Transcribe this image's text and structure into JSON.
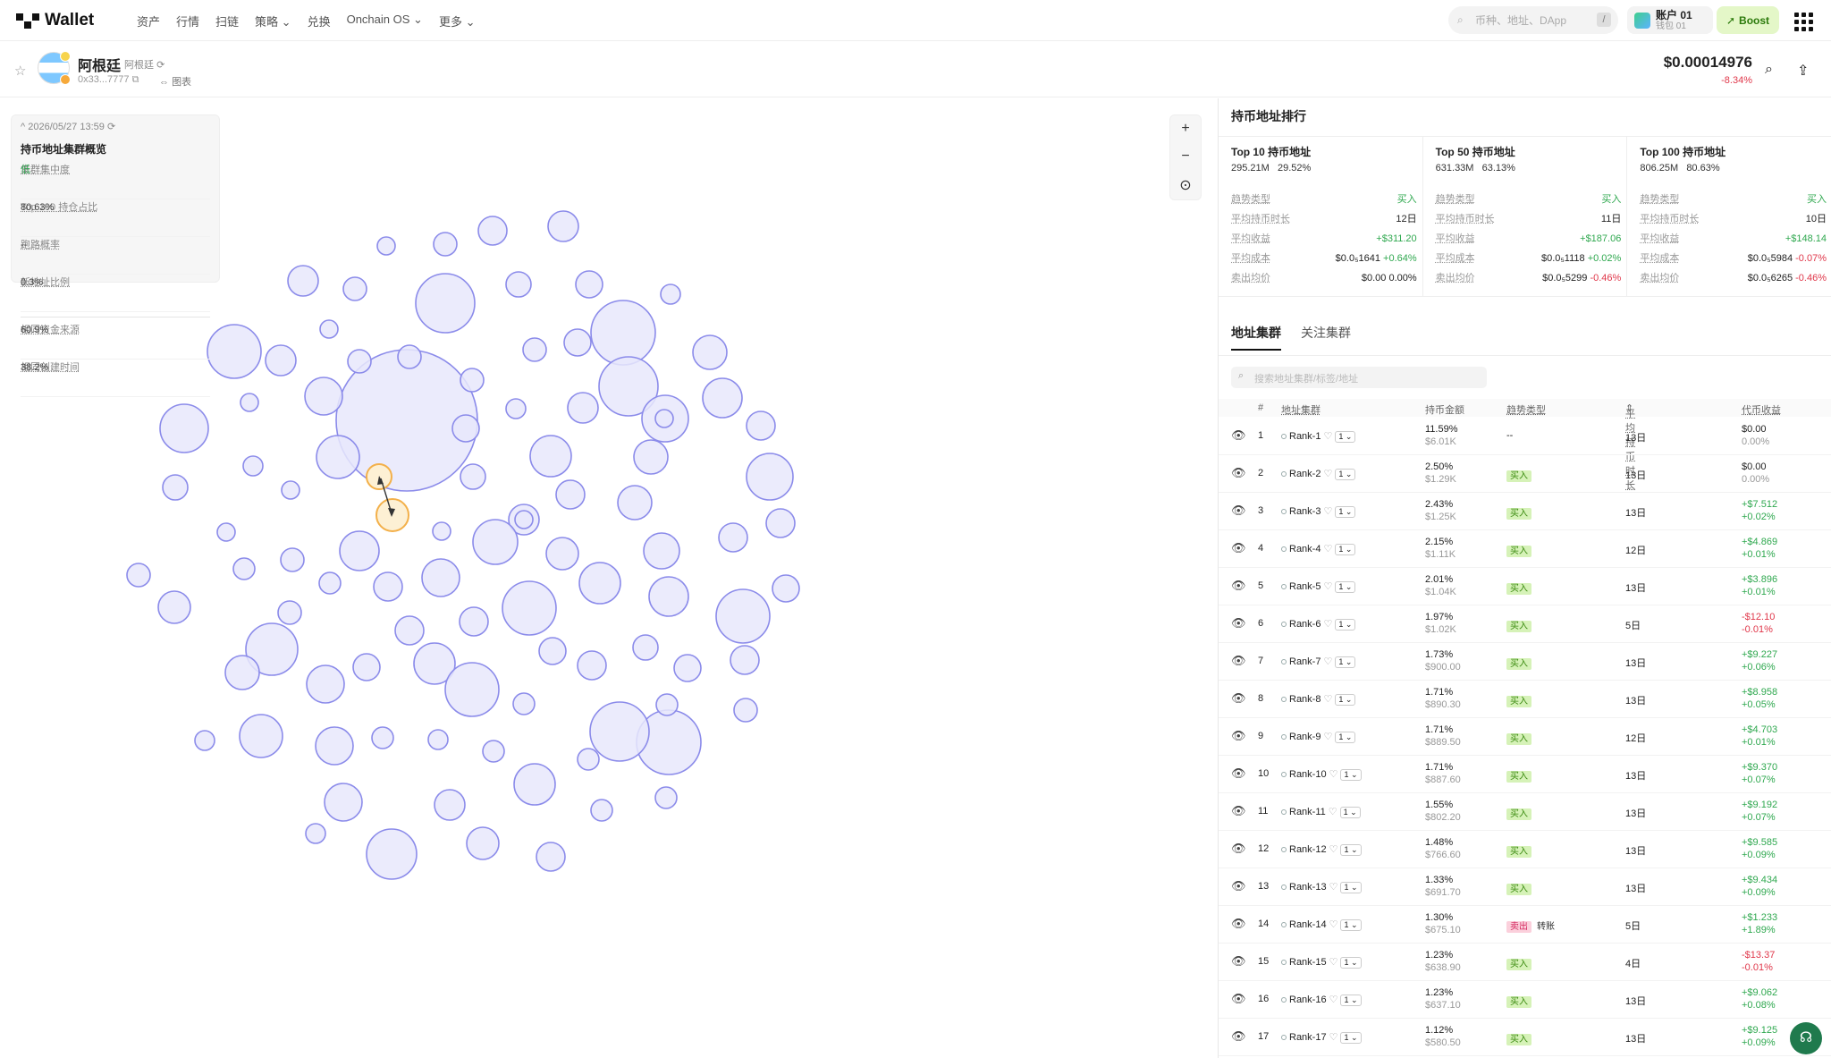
{
  "nav": {
    "logo": "Wallet",
    "menu": [
      "资产",
      "行情",
      "扫链",
      "策略",
      "兑换",
      "Onchain OS",
      "更多"
    ],
    "search_placeholder": "币种、地址、DApp",
    "search_shortcut": "/",
    "account_name": "账户 01",
    "account_sub": "钱包 01",
    "boost_label": "Boost"
  },
  "token": {
    "name": "阿根廷",
    "sub": "阿根廷",
    "address": "0x33...7777",
    "chart_link": "图表",
    "price": "$0.00014976",
    "change": "-8.34%"
  },
  "snapshot": {
    "datetime": "2026/05/27 13:59",
    "title": "持币地址集群概览",
    "rows": [
      {
        "k": "集群集中度",
        "v": "低",
        "green": true
      },
      {
        "k": "Top 100 持仓占比",
        "v": "80.63%"
      },
      {
        "k": "跑路概率",
        "v": "--"
      },
      {
        "k": "新地址比例",
        "v": "0.3%"
      }
    ],
    "rows2": [
      {
        "k": "相同资金来源",
        "v": "60.9%"
      },
      {
        "k": "相同创建时间",
        "v": "38.2%"
      }
    ]
  },
  "zoom": {
    "in": "+",
    "out": "−",
    "center": "⊙"
  },
  "panel": {
    "title": "持币地址排行",
    "tops": [
      {
        "title": "Top 10 持币地址",
        "amount": "295.21M",
        "pct": "29.52%",
        "trend": "买入",
        "hold": "12日",
        "profit": "+$311.20",
        "cost": "$0.0₅1641",
        "cost_chg": "+0.64%",
        "sell": "$0.00",
        "sell_chg": "0.00%"
      },
      {
        "title": "Top 50 持币地址",
        "amount": "631.33M",
        "pct": "63.13%",
        "trend": "买入",
        "hold": "11日",
        "profit": "+$187.06",
        "cost": "$0.0₅1118",
        "cost_chg": "+0.02%",
        "sell": "$0.0₅5299",
        "sell_chg": "-0.46%"
      },
      {
        "title": "Top 100 持币地址",
        "amount": "806.25M",
        "pct": "80.63%",
        "trend": "买入",
        "hold": "10日",
        "profit": "+$148.14",
        "cost": "$0.0₅5984",
        "cost_chg": "-0.07%",
        "sell": "$0.0₅6265",
        "sell_chg": "-0.46%"
      }
    ],
    "labels": {
      "trend": "趋势类型",
      "hold": "平均持币时长",
      "profit": "平均收益",
      "cost": "平均成本",
      "sell": "卖出均价"
    },
    "tabs": [
      "地址集群",
      "关注集群"
    ],
    "search_placeholder": "搜索地址集群/标签/地址",
    "headers": [
      "#",
      "地址集群",
      "持币金额",
      "趋势类型",
      "平均持币时长",
      "代币收益"
    ],
    "rows": [
      {
        "n": "1",
        "name": "Rank-1",
        "pct": "11.59%",
        "usd": "$6.01K",
        "trend": "--",
        "hold": "13日",
        "pnl": "$0.00",
        "pnl_pct": "0.00%",
        "c": "n"
      },
      {
        "n": "2",
        "name": "Rank-2",
        "pct": "2.50%",
        "usd": "$1.29K",
        "trend": "买入",
        "hold": "13日",
        "pnl": "$0.00",
        "pnl_pct": "0.00%",
        "c": "n"
      },
      {
        "n": "3",
        "name": "Rank-3",
        "pct": "2.43%",
        "usd": "$1.25K",
        "trend": "买入",
        "hold": "13日",
        "pnl": "+$7.512",
        "pnl_pct": "+0.02%",
        "c": "g"
      },
      {
        "n": "4",
        "name": "Rank-4",
        "pct": "2.15%",
        "usd": "$1.11K",
        "trend": "买入",
        "hold": "12日",
        "pnl": "+$4.869",
        "pnl_pct": "+0.01%",
        "c": "g"
      },
      {
        "n": "5",
        "name": "Rank-5",
        "pct": "2.01%",
        "usd": "$1.04K",
        "trend": "买入",
        "hold": "13日",
        "pnl": "+$3.896",
        "pnl_pct": "+0.01%",
        "c": "g"
      },
      {
        "n": "6",
        "name": "Rank-6",
        "pct": "1.97%",
        "usd": "$1.02K",
        "trend": "买入",
        "hold": "5日",
        "pnl": "-$12.10",
        "pnl_pct": "-0.01%",
        "c": "r"
      },
      {
        "n": "7",
        "name": "Rank-7",
        "pct": "1.73%",
        "usd": "$900.00",
        "trend": "买入",
        "hold": "13日",
        "pnl": "+$9.227",
        "pnl_pct": "+0.06%",
        "c": "g"
      },
      {
        "n": "8",
        "name": "Rank-8",
        "pct": "1.71%",
        "usd": "$890.30",
        "trend": "买入",
        "hold": "13日",
        "pnl": "+$8.958",
        "pnl_pct": "+0.05%",
        "c": "g"
      },
      {
        "n": "9",
        "name": "Rank-9",
        "pct": "1.71%",
        "usd": "$889.50",
        "trend": "买入",
        "hold": "12日",
        "pnl": "+$4.703",
        "pnl_pct": "+0.01%",
        "c": "g"
      },
      {
        "n": "10",
        "name": "Rank-10",
        "pct": "1.71%",
        "usd": "$887.60",
        "trend": "买入",
        "hold": "13日",
        "pnl": "+$9.370",
        "pnl_pct": "+0.07%",
        "c": "g"
      },
      {
        "n": "11",
        "name": "Rank-11",
        "pct": "1.55%",
        "usd": "$802.20",
        "trend": "买入",
        "hold": "13日",
        "pnl": "+$9.192",
        "pnl_pct": "+0.07%",
        "c": "g"
      },
      {
        "n": "12",
        "name": "Rank-12",
        "pct": "1.48%",
        "usd": "$766.60",
        "trend": "买入",
        "hold": "13日",
        "pnl": "+$9.585",
        "pnl_pct": "+0.09%",
        "c": "g"
      },
      {
        "n": "13",
        "name": "Rank-13",
        "pct": "1.33%",
        "usd": "$691.70",
        "trend": "买入",
        "hold": "13日",
        "pnl": "+$9.434",
        "pnl_pct": "+0.09%",
        "c": "g"
      },
      {
        "n": "14",
        "name": "Rank-14",
        "pct": "1.30%",
        "usd": "$675.10",
        "trend": "卖出",
        "xfer": "转账",
        "hold": "5日",
        "pnl": "+$1.233",
        "pnl_pct": "+1.89%",
        "c": "g"
      },
      {
        "n": "15",
        "name": "Rank-15",
        "pct": "1.23%",
        "usd": "$638.90",
        "trend": "买入",
        "hold": "4日",
        "pnl": "-$13.37",
        "pnl_pct": "-0.01%",
        "c": "r"
      },
      {
        "n": "16",
        "name": "Rank-16",
        "pct": "1.23%",
        "usd": "$637.10",
        "trend": "买入",
        "hold": "13日",
        "pnl": "+$9.062",
        "pnl_pct": "+0.08%",
        "c": "g"
      },
      {
        "n": "17",
        "name": "Rank-17",
        "pct": "1.12%",
        "usd": "$580.50",
        "trend": "买入",
        "hold": "13日",
        "pnl": "+$9.125",
        "pnl_pct": "+0.09%",
        "c": "g"
      }
    ]
  },
  "colors": {
    "bubble_fill": "#e8e8fb",
    "bubble_stroke": "#8b8bea",
    "highlight_fill": "#fdf0d4",
    "highlight_stroke": "#f3b04a",
    "green": "#2fa84f",
    "red": "#e0374a"
  }
}
